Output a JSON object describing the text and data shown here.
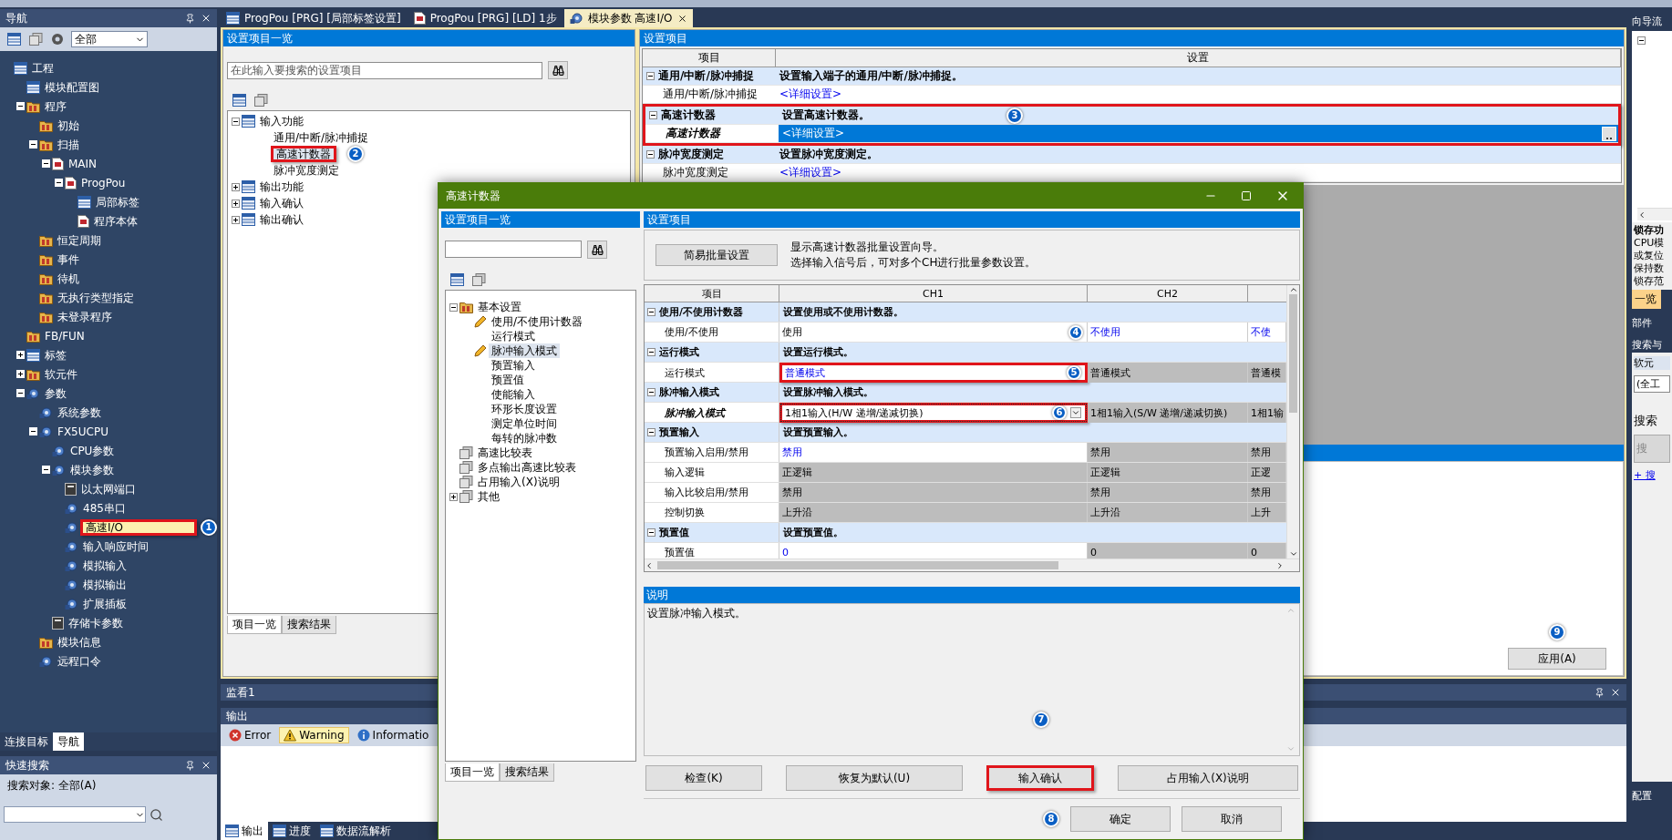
{
  "nav": {
    "title": "导航",
    "filter": "全部",
    "tree": [
      {
        "label": "工程",
        "kind": "table",
        "selected": false,
        "children": [
          {
            "label": "模块配置图",
            "kind": "table",
            "selected": false
          },
          {
            "label": "程序",
            "kind": "folder",
            "selected": false,
            "expanded": true,
            "children": [
              {
                "label": "初始",
                "kind": "folder",
                "selected": false
              },
              {
                "label": "扫描",
                "kind": "folder",
                "selected": false,
                "expanded": true,
                "children": [
                  {
                    "label": "MAIN",
                    "kind": "document",
                    "selected": false,
                    "expanded": true,
                    "children": [
                      {
                        "label": "ProgPou",
                        "kind": "document",
                        "selected": false,
                        "expanded": true,
                        "children": [
                          {
                            "label": "局部标签",
                            "kind": "table",
                            "selected": false
                          },
                          {
                            "label": "程序本体",
                            "kind": "document",
                            "selected": false
                          }
                        ]
                      }
                    ]
                  }
                ]
              },
              {
                "label": "恒定周期",
                "kind": "folder",
                "selected": false
              },
              {
                "label": "事件",
                "kind": "folder",
                "selected": false
              },
              {
                "label": "待机",
                "kind": "folder",
                "selected": false
              },
              {
                "label": "无执行类型指定",
                "kind": "folder",
                "selected": false
              },
              {
                "label": "未登录程序",
                "kind": "folder",
                "selected": false
              }
            ]
          },
          {
            "label": "FB/FUN",
            "kind": "folder",
            "selected": false
          },
          {
            "label": "标签",
            "kind": "table",
            "selected": false,
            "expanded": false
          },
          {
            "label": "软元件",
            "kind": "folder",
            "selected": false,
            "expanded": false
          },
          {
            "label": "参数",
            "kind": "gear",
            "selected": false,
            "expanded": true,
            "children": [
              {
                "label": "系统参数",
                "kind": "gear",
                "selected": false
              },
              {
                "label": "FX5UCPU",
                "kind": "gear",
                "selected": false,
                "expanded": true,
                "children": [
                  {
                    "label": "CPU参数",
                    "kind": "gear",
                    "selected": false
                  },
                  {
                    "label": "模块参数",
                    "kind": "gear",
                    "selected": false,
                    "expanded": true,
                    "children": [
                      {
                        "label": "以太网端口",
                        "kind": "card",
                        "selected": false
                      },
                      {
                        "label": "485串口",
                        "kind": "gear",
                        "selected": false
                      },
                      {
                        "label": "高速I/O",
                        "kind": "gear",
                        "selected": true
                      },
                      {
                        "label": "输入响应时间",
                        "kind": "gear",
                        "selected": false
                      },
                      {
                        "label": "模拟输入",
                        "kind": "gear",
                        "selected": false
                      },
                      {
                        "label": "模拟输出",
                        "kind": "gear",
                        "selected": false
                      },
                      {
                        "label": "扩展插板",
                        "kind": "gear",
                        "selected": false
                      }
                    ]
                  },
                  {
                    "label": "存储卡参数",
                    "kind": "card",
                    "selected": false
                  }
                ]
              },
              {
                "label": "模块信息",
                "kind": "folder",
                "selected": false
              },
              {
                "label": "远程口令",
                "kind": "gear",
                "selected": false
              }
            ]
          }
        ]
      }
    ],
    "tabs": [
      {
        "label": "连接目标",
        "selected": false
      },
      {
        "label": "导航",
        "selected": true
      }
    ]
  },
  "quick_search": {
    "title": "快速搜索",
    "scope": "搜索对象: 全部(A)"
  },
  "doc_tabs": [
    {
      "label": "ProgPou [PRG] [局部标签设置]",
      "selected": false
    },
    {
      "label": "ProgPou [PRG] [LD] 1步",
      "selected": false
    },
    {
      "label": "模块参数 高速I/O",
      "selected": true
    }
  ],
  "item_list": {
    "title": "设置项目一览",
    "search": {
      "placeholder": "在此输入要搜索的设置项目"
    },
    "tree": [
      {
        "label": "输入功能",
        "kind": "table",
        "selected": false,
        "expanded": true,
        "children": [
          {
            "label": "通用/中断/脉冲捕捉",
            "kind": "none",
            "selected": false
          },
          {
            "label": "高速计数器",
            "kind": "none",
            "selected": true
          },
          {
            "label": "脉冲宽度测定",
            "kind": "none",
            "selected": false
          }
        ]
      },
      {
        "label": "输出功能",
        "kind": "table",
        "selected": false,
        "expanded": false
      },
      {
        "label": "输入确认",
        "kind": "table",
        "selected": false,
        "expanded": false
      },
      {
        "label": "输出确认",
        "kind": "table",
        "selected": false,
        "expanded": false
      }
    ],
    "tabs": [
      {
        "label": "项目一览",
        "selected": true
      },
      {
        "label": "搜索结果",
        "selected": false
      }
    ]
  },
  "settings": {
    "title": "设置项目",
    "columns": [
      "项目",
      "设置"
    ],
    "groups": [
      {
        "name": "通用/中断/脉冲捕捉",
        "desc": "设置输入端子的通用/中断/脉冲捕捉。",
        "expanded": true,
        "rows": [
          {
            "name": "通用/中断/脉冲捕捉",
            "value": "<详细设置>",
            "selected": false
          }
        ]
      },
      {
        "name": "高速计数器",
        "desc": "设置高速计数器。",
        "expanded": true,
        "rows": [
          {
            "name": "高速计数器",
            "value": "<详细设置>",
            "selected": true
          }
        ]
      },
      {
        "name": "脉冲宽度测定",
        "desc": "设置脉冲宽度测定。",
        "expanded": true,
        "rows": [
          {
            "name": "脉冲宽度测定",
            "value": "<详细设置>",
            "selected": false
          }
        ]
      }
    ],
    "apply_button": "应用(A)"
  },
  "watch": {
    "title": "监看1"
  },
  "output": {
    "title": "输出",
    "filters": [
      {
        "label": "Error",
        "kind": "error",
        "selected": false
      },
      {
        "label": "Warning",
        "kind": "warning",
        "selected": true
      },
      {
        "label": "Informatio",
        "kind": "info",
        "selected": false
      }
    ],
    "tabs": [
      {
        "label": "输出",
        "selected": true
      },
      {
        "label": "进度",
        "selected": false
      },
      {
        "label": "数据流解析",
        "selected": false
      }
    ]
  },
  "right_panel": {
    "title": "向导流",
    "heading": "锁存功",
    "lines": [
      "CPU模",
      "或复位",
      "保持数",
      "锁存范"
    ],
    "tab": "一览",
    "parts_title": "部件",
    "search_title": "搜索与",
    "device_button": "软元",
    "scope_field": "(全工",
    "prompt": "搜索",
    "search_button": "搜",
    "link": "+ 搜",
    "config_title": "配置"
  },
  "dialog": {
    "title": "高速计数器",
    "list": {
      "title": "设置项目一览",
      "tree": [
        {
          "label": "基本设置",
          "kind": "folder",
          "selected": false,
          "expanded": true,
          "children": [
            {
              "label": "使用/不使用计数器",
              "kind": "pencil",
              "selected": false
            },
            {
              "label": "运行模式",
              "kind": "none",
              "selected": false
            },
            {
              "label": "脉冲输入模式",
              "kind": "pencil",
              "selected": true
            },
            {
              "label": "预置输入",
              "kind": "none",
              "selected": false
            },
            {
              "label": "预置值",
              "kind": "none",
              "selected": false
            },
            {
              "label": "使能输入",
              "kind": "none",
              "selected": false
            },
            {
              "label": "环形长度设置",
              "kind": "none",
              "selected": false
            },
            {
              "label": "测定单位时间",
              "kind": "none",
              "selected": false
            },
            {
              "label": "每转的脉冲数",
              "kind": "none",
              "selected": false
            }
          ]
        },
        {
          "label": "高速比较表",
          "kind": "stack",
          "selected": false
        },
        {
          "label": "多点输出高速比较表",
          "kind": "stack",
          "selected": false
        },
        {
          "label": "占用输入(X)说明",
          "kind": "stack",
          "selected": false
        },
        {
          "label": "其他",
          "kind": "stack",
          "selected": false,
          "expanded": false
        }
      ],
      "tabs": [
        {
          "label": "项目一览",
          "selected": true
        },
        {
          "label": "搜索结果",
          "selected": false
        }
      ]
    },
    "settings": {
      "title": "设置项目",
      "wizard_button": "简易批量设置",
      "wizard_text": [
        "显示高速计数器批量设置向导。",
        "选择输入信号后，可对多个CH进行批量参数设置。"
      ],
      "columns": [
        "项目",
        "CH1",
        "CH2"
      ],
      "groups": [
        {
          "name": "使用/不使用计数器",
          "desc": "设置使用或不使用计数器。",
          "expanded": true,
          "rows": [
            {
              "name": "使用/不使用",
              "selected": false,
              "cells": [
                {
                  "text": "使用",
                  "kind": "set"
                },
                {
                  "text": "不使用",
                  "kind": "default"
                },
                {
                  "text": "不使",
                  "kind": "default"
                }
              ]
            }
          ]
        },
        {
          "name": "运行模式",
          "desc": "设置运行模式。",
          "expanded": true,
          "rows": [
            {
              "name": "运行模式",
              "selected": false,
              "cells": [
                {
                  "text": "普通模式",
                  "kind": "default"
                },
                {
                  "text": "普通模式",
                  "kind": "disabled"
                },
                {
                  "text": "普通模",
                  "kind": "disabled"
                }
              ]
            }
          ]
        },
        {
          "name": "脉冲输入模式",
          "desc": "设置脉冲输入模式。",
          "expanded": true,
          "rows": [
            {
              "name": "脉冲输入模式",
              "selected": true,
              "cells": [
                {
                  "text": "1相1输入(H/W 递增/递减切换)",
                  "kind": "dropdown"
                },
                {
                  "text": "1相1输入(S/W 递增/递减切换)",
                  "kind": "disabled"
                },
                {
                  "text": "1相1输",
                  "kind": "disabled"
                }
              ]
            }
          ]
        },
        {
          "name": "预置输入",
          "desc": "设置预置输入。",
          "expanded": true,
          "rows": [
            {
              "name": "预置输入启用/禁用",
              "selected": false,
              "cells": [
                {
                  "text": "禁用",
                  "kind": "default"
                },
                {
                  "text": "禁用",
                  "kind": "disabled"
                },
                {
                  "text": "禁用",
                  "kind": "disabled"
                }
              ]
            },
            {
              "name": "输入逻辑",
              "selected": false,
              "cells": [
                {
                  "text": "正逻辑",
                  "kind": "disabled"
                },
                {
                  "text": "正逻辑",
                  "kind": "disabled"
                },
                {
                  "text": "正逻",
                  "kind": "disabled"
                }
              ]
            },
            {
              "name": "输入比较启用/禁用",
              "selected": false,
              "cells": [
                {
                  "text": "禁用",
                  "kind": "disabled"
                },
                {
                  "text": "禁用",
                  "kind": "disabled"
                },
                {
                  "text": "禁用",
                  "kind": "disabled"
                }
              ]
            },
            {
              "name": "控制切换",
              "selected": false,
              "cells": [
                {
                  "text": "上升沿",
                  "kind": "disabled"
                },
                {
                  "text": "上升沿",
                  "kind": "disabled"
                },
                {
                  "text": "上升",
                  "kind": "disabled"
                }
              ]
            }
          ]
        },
        {
          "name": "预置值",
          "desc": "设置预置值。",
          "expanded": true,
          "rows": [
            {
              "name": "预置值",
              "selected": false,
              "cells": [
                {
                  "text": "0",
                  "kind": "default"
                },
                {
                  "text": "0",
                  "kind": "disabled"
                },
                {
                  "text": "0",
                  "kind": "disabled"
                }
              ]
            }
          ]
        }
      ]
    },
    "description": {
      "title": "说明",
      "text": "设置脉冲输入模式。"
    },
    "actions": [
      "检查(K)",
      "恢复为默认(U)",
      "输入确认",
      "占用输入(X)说明"
    ],
    "footer": [
      "确定",
      "取消"
    ]
  },
  "markers": [
    "1",
    "2",
    "3",
    "4",
    "5",
    "6",
    "7",
    "8",
    "9"
  ]
}
